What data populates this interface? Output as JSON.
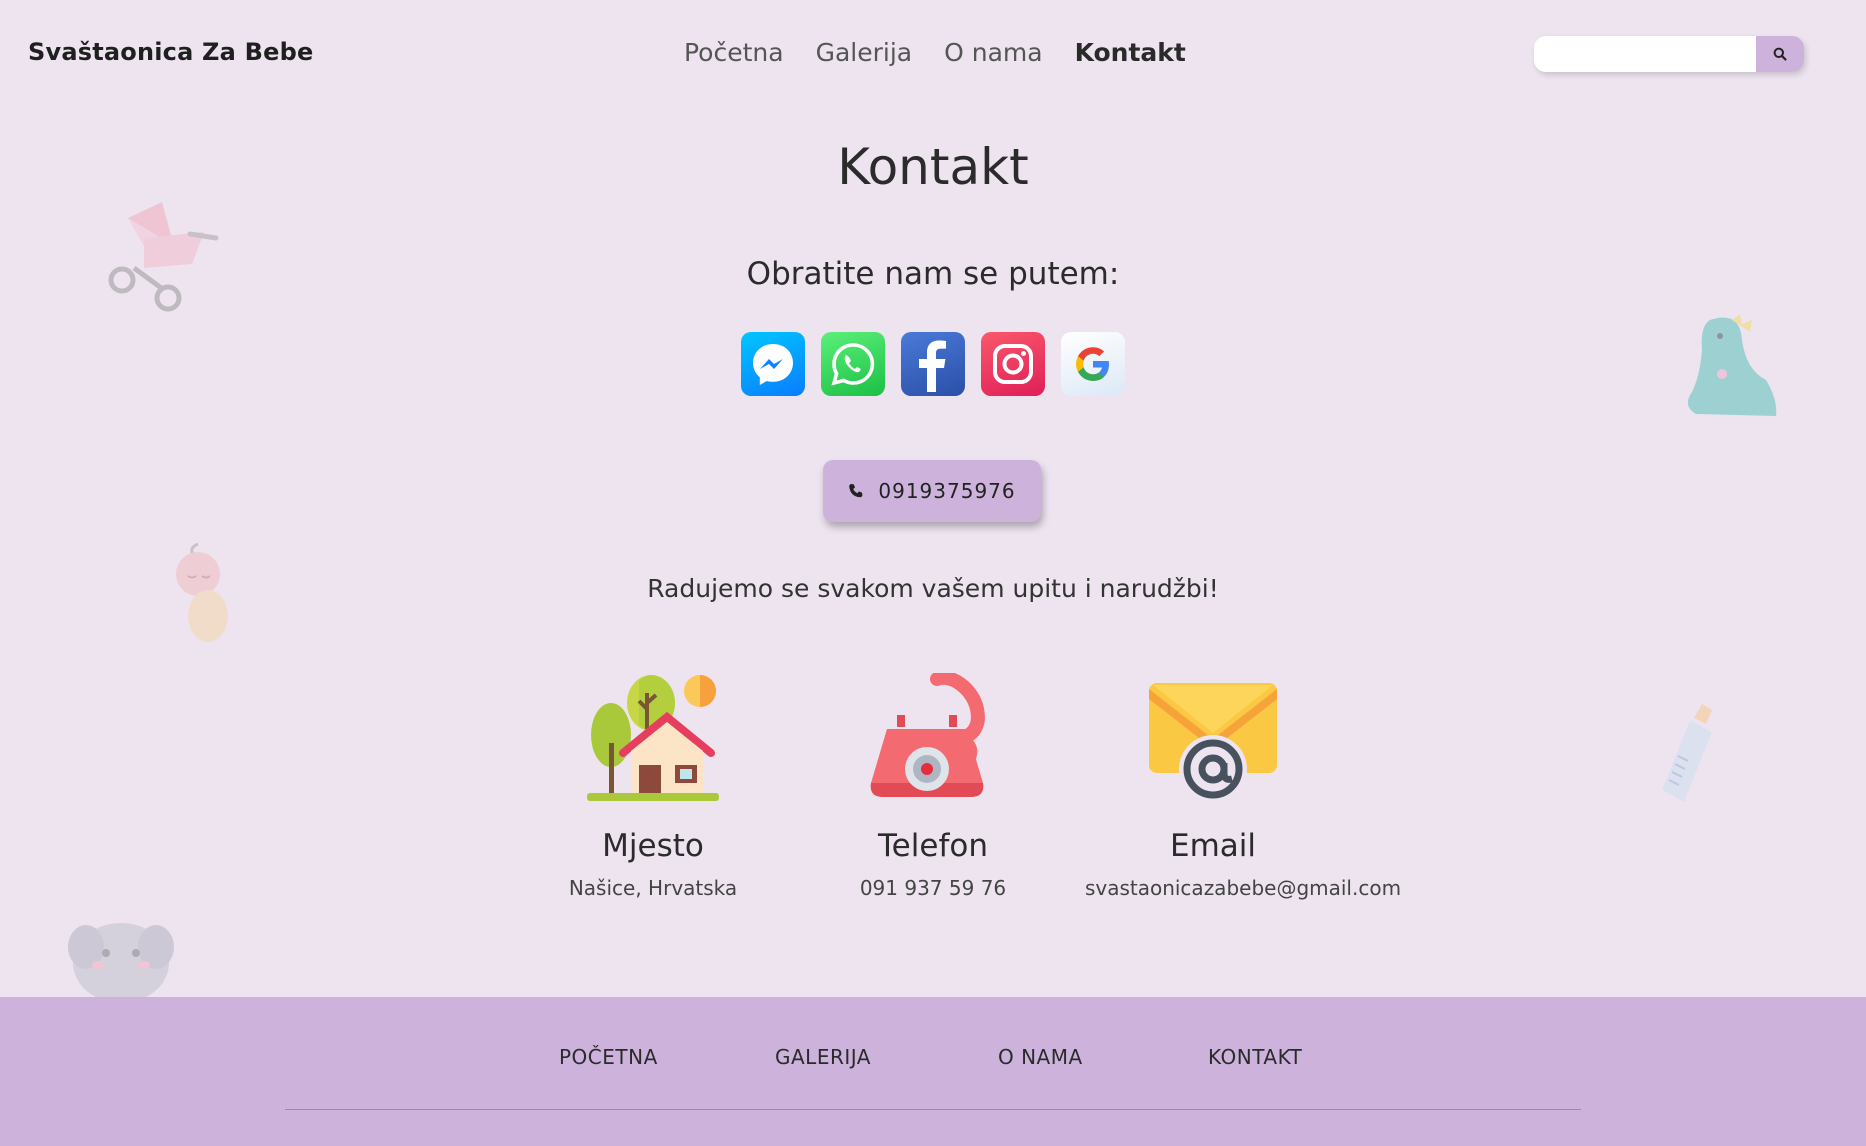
{
  "header": {
    "brand": "Svaštaonica Za Bebe",
    "nav": [
      "Početna",
      "Galerija",
      "O nama",
      "Kontakt"
    ],
    "active_nav": "Kontakt",
    "search": {
      "value": "",
      "placeholder": ""
    }
  },
  "main": {
    "title": "Kontakt",
    "subtitle": "Obratite nam se putem:",
    "social": [
      "messenger-icon",
      "whatsapp-icon",
      "facebook-icon",
      "instagram-icon",
      "google-icon"
    ],
    "phone_button": "0919375976",
    "tagline": "Radujemo se svakom vašem upitu i narudžbi!",
    "cards": [
      {
        "icon": "house-icon",
        "title": "Mjesto",
        "value": "Našice, Hrvatska"
      },
      {
        "icon": "telephone-icon",
        "title": "Telefon",
        "value": "091 937 59 76"
      },
      {
        "icon": "envelope-icon",
        "title": "Email",
        "value": "svastaonicazabebe@gmail.com"
      }
    ]
  },
  "footer": {
    "nav": [
      "POČETNA",
      "GALERIJA",
      "O NAMA",
      "KONTAKT"
    ]
  },
  "colors": {
    "background": "#ede4f0",
    "accent": "#cdb3dc"
  }
}
